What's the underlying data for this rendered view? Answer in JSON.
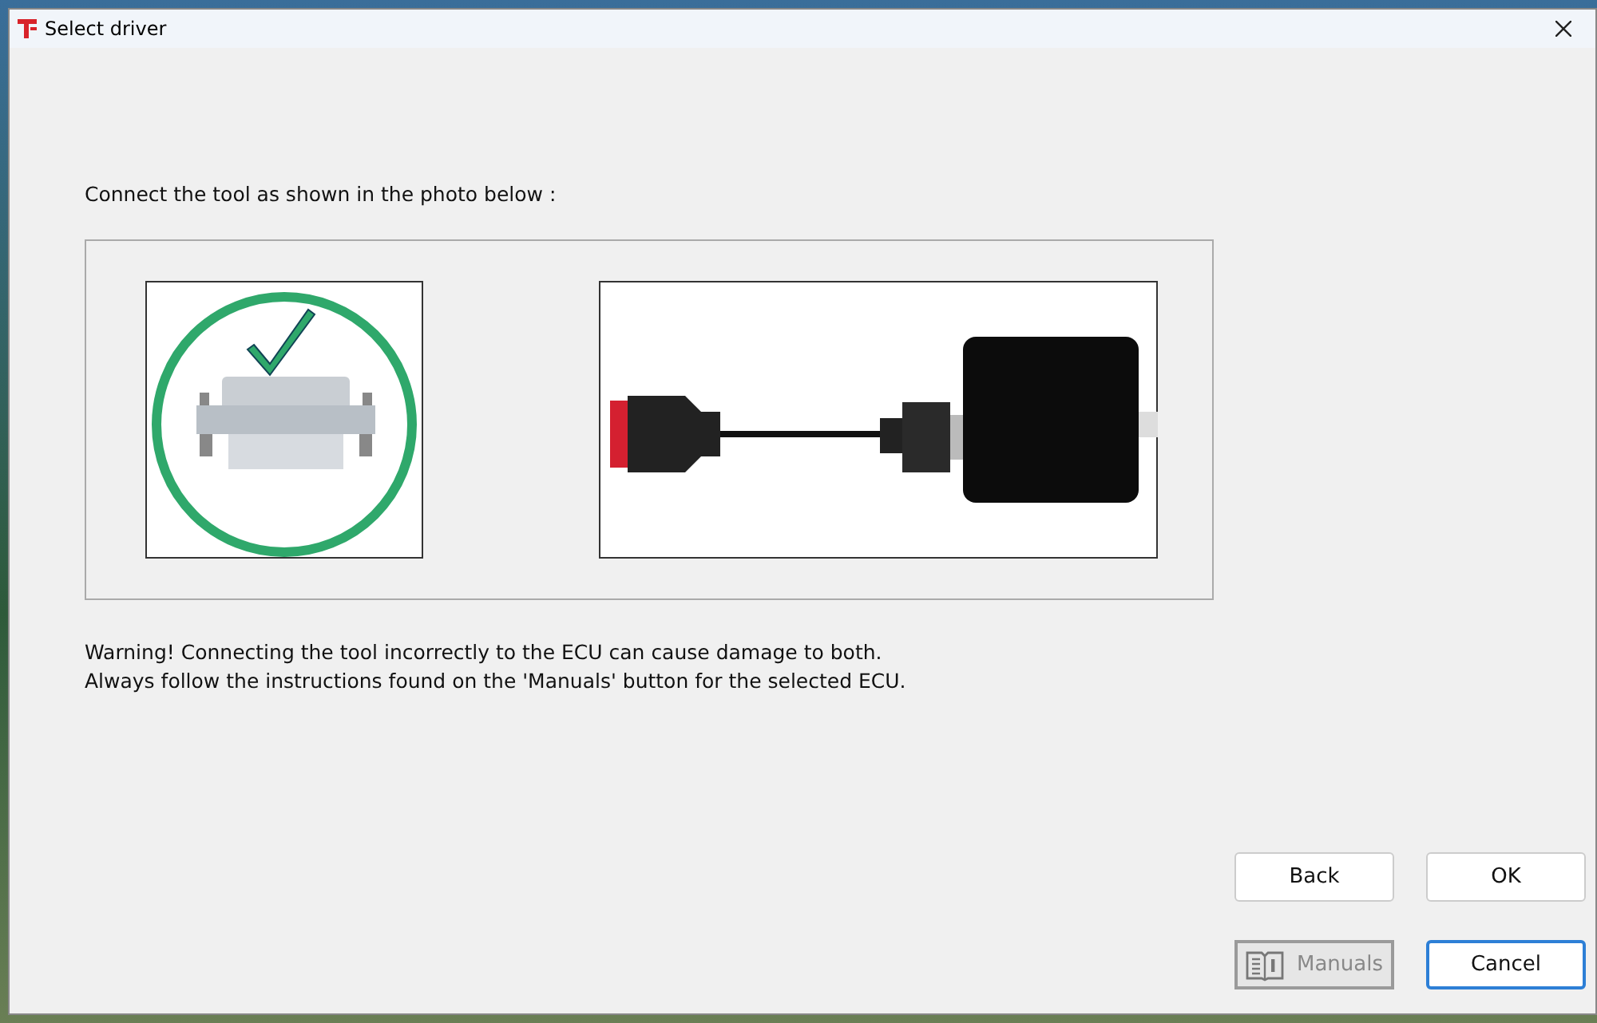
{
  "window": {
    "title": "Select driver"
  },
  "instruction": "Connect the tool as shown in the photo below :",
  "warning": [
    "Warning! Connecting the tool incorrectly to the ECU can cause damage to both.",
    "Always follow the instructions found on the 'Manuals' button for the selected ECU."
  ],
  "buttons": [
    {
      "label": "Back",
      "kind": "plain",
      "disabled": false,
      "focused": false
    },
    {
      "label": "OK",
      "kind": "plain",
      "disabled": false,
      "focused": false
    },
    {
      "label": "Manuals",
      "kind": "manual",
      "disabled": true,
      "focused": false
    },
    {
      "label": "Cancel",
      "kind": "plain",
      "disabled": false,
      "focused": true
    }
  ]
}
